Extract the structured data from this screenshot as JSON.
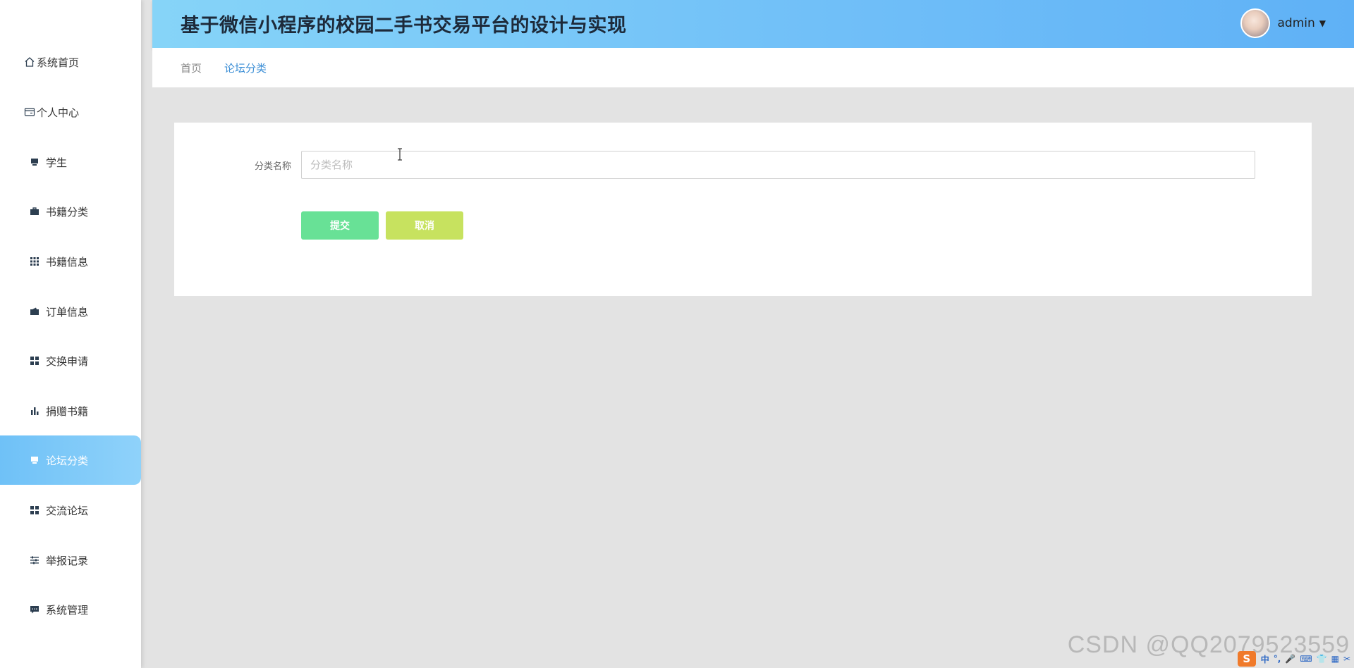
{
  "header": {
    "title": "基于微信小程序的校园二手书交易平台的设计与实现",
    "user_name": "admin"
  },
  "sidebar": {
    "items": [
      {
        "label": "系统首页",
        "icon": "home-icon"
      },
      {
        "label": "个人中心",
        "icon": "profile-card-icon"
      },
      {
        "label": "学生",
        "icon": "monitor-icon"
      },
      {
        "label": "书籍分类",
        "icon": "briefcase-icon"
      },
      {
        "label": "书籍信息",
        "icon": "grid-icon"
      },
      {
        "label": "订单信息",
        "icon": "wallet-icon"
      },
      {
        "label": "交换申请",
        "icon": "tiles-icon"
      },
      {
        "label": "捐赠书籍",
        "icon": "bar-chart-icon"
      },
      {
        "label": "论坛分类",
        "icon": "monitor-icon",
        "active": true
      },
      {
        "label": "交流论坛",
        "icon": "tiles-icon"
      },
      {
        "label": "举报记录",
        "icon": "sliders-icon"
      },
      {
        "label": "系统管理",
        "icon": "chat-icon"
      }
    ]
  },
  "breadcrumb": {
    "home": "首页",
    "current": "论坛分类"
  },
  "form": {
    "category_label": "分类名称",
    "category_placeholder": "分类名称",
    "category_value": "",
    "submit_label": "提交",
    "cancel_label": "取消"
  },
  "watermark": "CSDN @QQ2079523559",
  "ime": {
    "logo": "S",
    "items": [
      "中",
      "°,",
      "🎤",
      "⌨",
      "👕",
      "▦",
      "✂"
    ]
  },
  "colors": {
    "header_gradient_start": "#86d4f8",
    "header_gradient_end": "#5fb1f6",
    "sidebar_active": "#6fc1f7",
    "submit_button": "#68e196",
    "cancel_button": "#c7e25f",
    "breadcrumb_active": "#3d8fd6"
  }
}
